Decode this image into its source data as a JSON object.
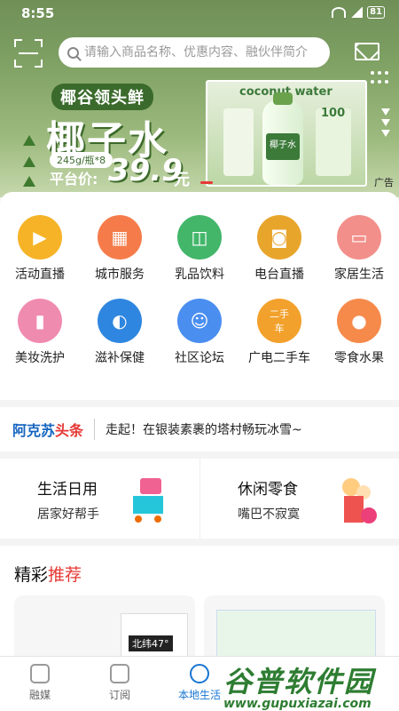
{
  "status": {
    "time": "8:55",
    "battery": "81"
  },
  "search": {
    "placeholder": "请输入商品名称、优惠内容、融伙伴简介"
  },
  "banner": {
    "pill": "椰谷领头鲜",
    "title": "椰子水",
    "spec": "245g/瓶*8",
    "price_label": "平台价:",
    "price": "39.9",
    "price_unit": "元",
    "product_text": "coconut water",
    "product_hundred": "100",
    "bottle_label": "椰子水",
    "ad_label": "广告"
  },
  "categories": [
    {
      "label": "活动直播",
      "color": "#f6b327",
      "icon": "video-camera-icon",
      "glyph": "▶"
    },
    {
      "label": "城市服务",
      "color": "#f57c4a",
      "icon": "buildings-icon",
      "glyph": "▦"
    },
    {
      "label": "乳品饮料",
      "color": "#43b66a",
      "icon": "bottle-icon",
      "glyph": "◫"
    },
    {
      "label": "电台直播",
      "color": "#e8a52c",
      "icon": "radio-icon",
      "glyph": "◙"
    },
    {
      "label": "家居生活",
      "color": "#f28f8a",
      "icon": "sofa-icon",
      "glyph": "▭"
    },
    {
      "label": "美妆洗护",
      "color": "#f08bb0",
      "icon": "cosmetics-icon",
      "glyph": "▮"
    },
    {
      "label": "滋补保健",
      "color": "#2f86e0",
      "icon": "capsule-icon",
      "glyph": "◐"
    },
    {
      "label": "社区论坛",
      "color": "#4a8ef0",
      "icon": "community-house-icon",
      "glyph": "☺"
    },
    {
      "label": "广电二手车",
      "color": "#f2a12c",
      "icon": "second-hand-car-icon",
      "glyph": "二手车"
    },
    {
      "label": "零食水果",
      "color": "#f58a4b",
      "icon": "peach-icon",
      "glyph": "●"
    }
  ],
  "ticker": {
    "brand_blue": "阿克苏",
    "brand_red": "头条",
    "news": "走起！在银装素裹的塔村畅玩冰雪~"
  },
  "promos": [
    {
      "title": "生活日用",
      "subtitle": "居家好帮手"
    },
    {
      "title": "休闲零食",
      "subtitle": "嘴巴不寂寞"
    }
  ],
  "recommend": {
    "title_black": "精彩",
    "title_red": "推荐",
    "card1_text": "北纬47°"
  },
  "tabs": [
    {
      "label": "融媒",
      "active": false
    },
    {
      "label": "订阅",
      "active": false
    },
    {
      "label": "本地生活",
      "active": true
    }
  ],
  "watermark": {
    "big": "谷普软件园",
    "small": "www.gupuxiazai.com"
  },
  "colors": {
    "accent": "#1976d2",
    "red": "#e53935",
    "green": "#3c7a3a"
  }
}
